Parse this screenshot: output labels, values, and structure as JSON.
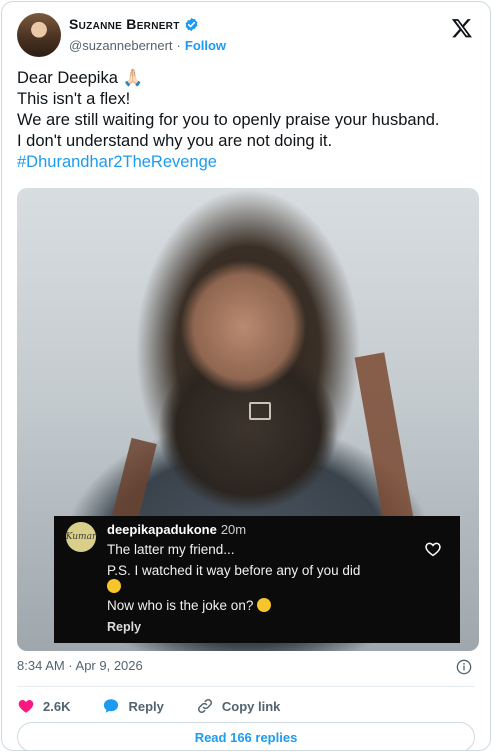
{
  "author": {
    "name": "Suzanne Bernert",
    "handle": "@suzannebernert",
    "separator": "·",
    "follow_label": "Follow"
  },
  "tweet": {
    "lines": [
      "Dear Deepika 🙏🏻",
      "This isn't a flex!",
      "We are still waiting for you to openly praise your husband.",
      "I don't understand why you are not doing it."
    ],
    "hashtag": "#Dhurandhar2TheRevenge"
  },
  "embedded_comment": {
    "username": "deepikapadukone",
    "time": "20m",
    "avatar_text": "Kumar",
    "lines": [
      "The latter my friend...",
      "P.S. I watched it way before any of you did",
      "Now who is the joke on?"
    ],
    "reply_label": "Reply"
  },
  "meta": {
    "timestamp": "8:34 AM · Apr 9, 2026"
  },
  "actions": {
    "likes": "2.6K",
    "reply_label": "Reply",
    "copy_link_label": "Copy link"
  },
  "read_replies_label": "Read 166 replies",
  "colors": {
    "accent": "#1d9bf0",
    "like": "#f91880",
    "text_secondary": "#536471"
  }
}
